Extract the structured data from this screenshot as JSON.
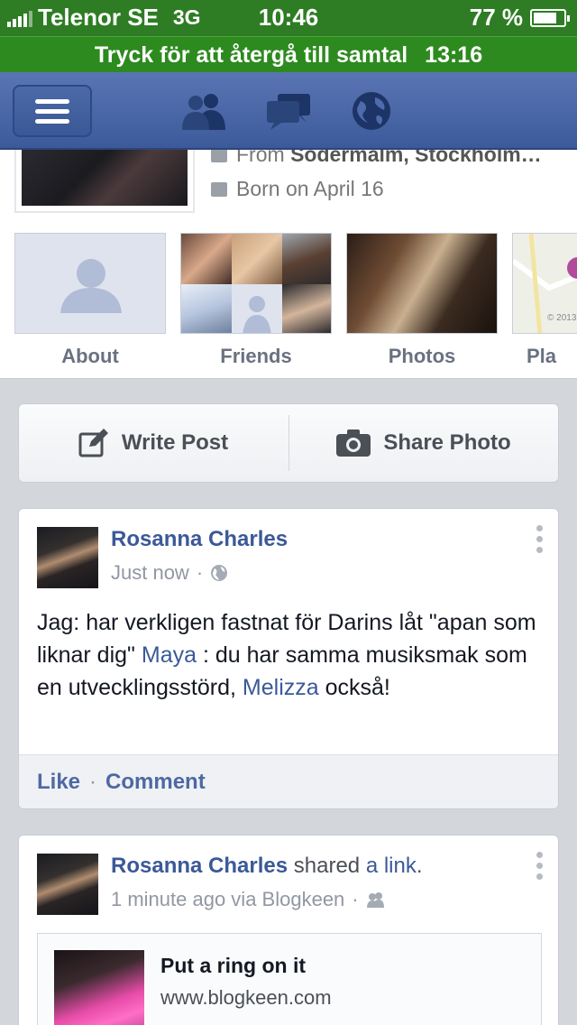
{
  "status_bar": {
    "carrier": "Telenor SE",
    "network": "3G",
    "time": "10:46",
    "battery": "77 %",
    "battery_level": 0.77
  },
  "call_bar": {
    "text": "Tryck för att återgå till samtal",
    "duration": "13:16"
  },
  "nav": {
    "icons": [
      "menu-icon",
      "friends-icon",
      "messages-icon",
      "globe-icon"
    ]
  },
  "profile": {
    "from_prefix": "From",
    "from_location": "Södermalm, Stockholm…",
    "born": "Born on April 16"
  },
  "tiles": [
    {
      "label": "About"
    },
    {
      "label": "Friends"
    },
    {
      "label": "Photos"
    },
    {
      "label": "Pla",
      "map_caption": "© 2013"
    }
  ],
  "actions": {
    "write_post": "Write Post",
    "share_photo": "Share Photo"
  },
  "posts": [
    {
      "author": "Rosanna Charles",
      "time": "Just now",
      "text_1": "Jag: har verkligen fastnat för Darins låt \"apan som liknar dig\"",
      "mention_1": "Maya",
      "text_2": ": du har samma musiksmak som en utvecklingsstörd,",
      "mention_2": "Melizza",
      "text_3": "också!",
      "like": "Like",
      "comment": "Comment"
    },
    {
      "author": "Rosanna Charles",
      "shared": "shared",
      "link_word": "a link",
      "period": ".",
      "time": "1 minute ago via Blogkeen",
      "link_title": "Put a ring on it",
      "link_url": "www.blogkeen.com"
    }
  ],
  "colors": {
    "fb_blue": "#3b5998",
    "call_green": "#2d8a1f",
    "background": "#d3d6db"
  }
}
